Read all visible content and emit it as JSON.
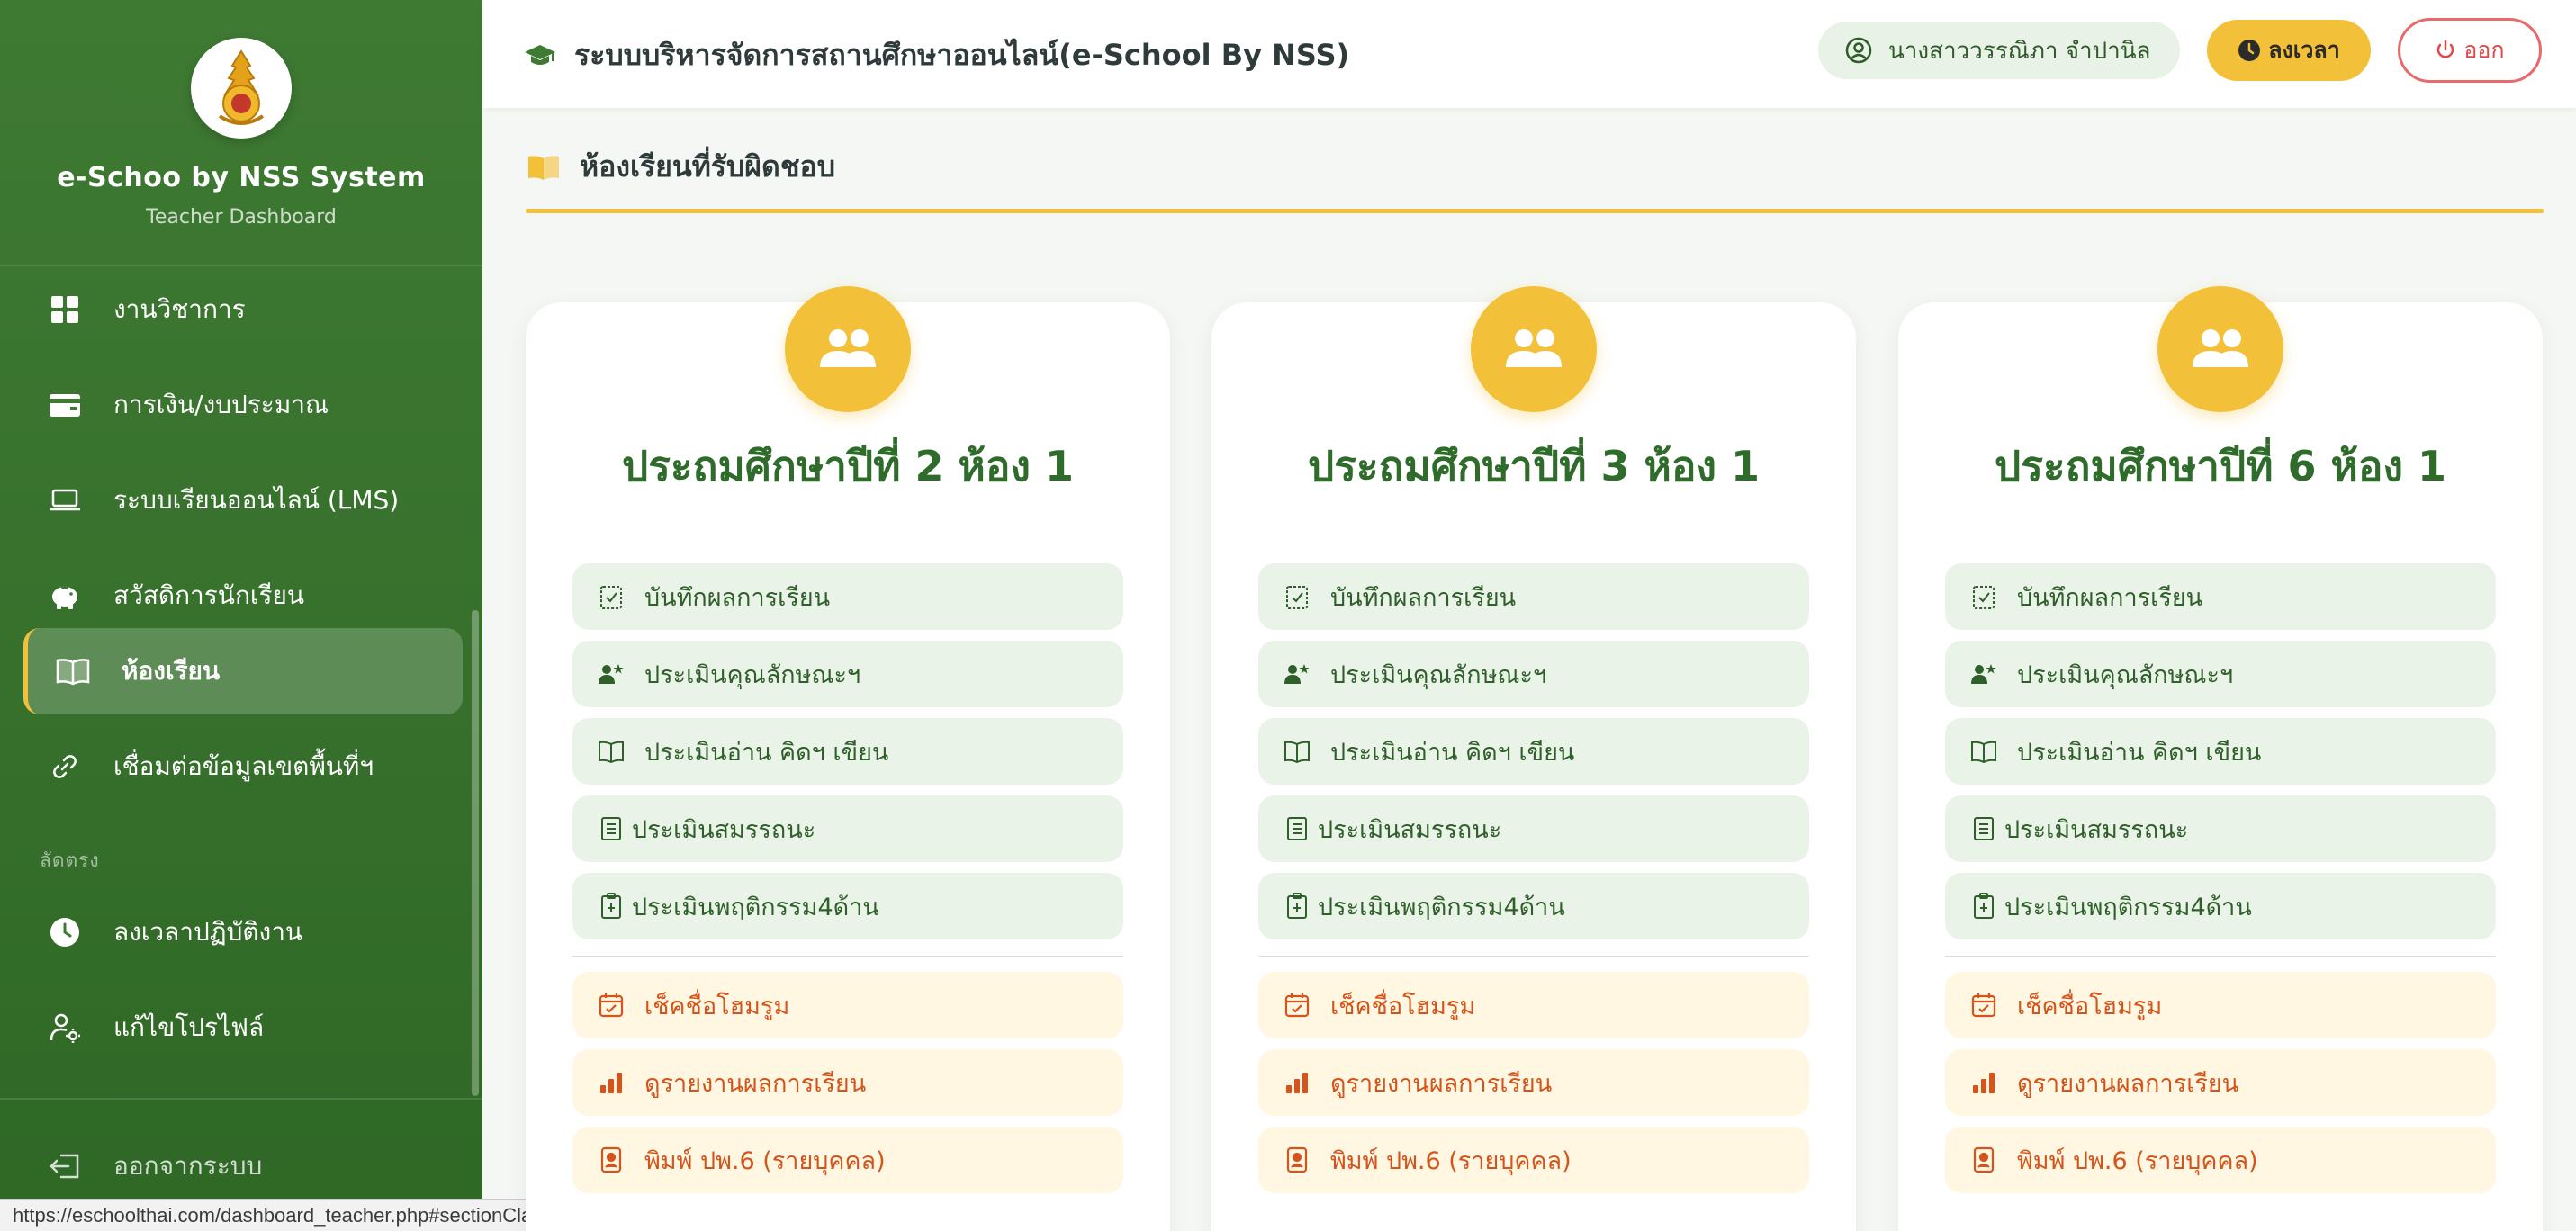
{
  "sidebar": {
    "brand_title": "e-Schoo by NSS System",
    "brand_subtitle": "Teacher Dashboard",
    "items": [
      {
        "label": "งานวิชาการ",
        "icon": "grid-icon"
      },
      {
        "label": "การเงิน/งบประมาณ",
        "icon": "wallet-icon"
      },
      {
        "label": "ระบบเรียนออนไลน์ (LMS)",
        "icon": "laptop-icon"
      },
      {
        "label": "สวัสดิการนักเรียน",
        "icon": "piggy-bank-icon"
      },
      {
        "label": "ห้องเรียน",
        "icon": "book-open-icon",
        "active": true
      },
      {
        "label": "เชื่อมต่อข้อมูลเขตพื้นที่ฯ",
        "icon": "link-icon"
      }
    ],
    "section_shortcut": "ลัดตรง",
    "shortcuts": [
      {
        "label": "ลงเวลาปฏิบัติงาน",
        "icon": "clock-icon"
      },
      {
        "label": "แก้ไขโปรไฟล์",
        "icon": "user-gear-icon"
      }
    ],
    "logout_label": "ออกจากระบบ"
  },
  "status_url": "https://eschoolthai.com/dashboard_teacher.php#sectionClassroom",
  "header": {
    "title": "ระบบบริหารจัดการสถานศึกษาออนไลน์(e-School By NSS)",
    "user_name": "นางสาววรรณิภา จำปานิล",
    "clock_button": "ลงเวลา",
    "logout_button": "ออก"
  },
  "section": {
    "title": "ห้องเรียนที่รับผิดชอบ"
  },
  "colors": {
    "sidebar": "#3f7a33",
    "accent": "#f3c03a",
    "title_green": "#2f6b2a",
    "orange_text": "#d4541c",
    "logout_red": "#e04a4a"
  },
  "classrooms": [
    {
      "title": "ประถมศึกษาปีที่ 2 ห้อง 1",
      "green_actions": [
        "บันทึกผลการเรียน",
        "ประเมินคุณลักษณะฯ",
        "ประเมินอ่าน คิดฯ เขียน",
        "ประเมินสมรรถนะ",
        "ประเมินพฤติกรรม4ด้าน"
      ],
      "orange_actions": [
        "เช็คชื่อโฮมรูม",
        "ดูรายงานผลการเรียน",
        "พิมพ์ ปพ.6 (รายบุคคล)"
      ]
    },
    {
      "title": "ประถมศึกษาปีที่ 3 ห้อง 1",
      "green_actions": [
        "บันทึกผลการเรียน",
        "ประเมินคุณลักษณะฯ",
        "ประเมินอ่าน คิดฯ เขียน",
        "ประเมินสมรรถนะ",
        "ประเมินพฤติกรรม4ด้าน"
      ],
      "orange_actions": [
        "เช็คชื่อโฮมรูม",
        "ดูรายงานผลการเรียน",
        "พิมพ์ ปพ.6 (รายบุคคล)"
      ]
    },
    {
      "title": "ประถมศึกษาปีที่ 6 ห้อง 1",
      "green_actions": [
        "บันทึกผลการเรียน",
        "ประเมินคุณลักษณะฯ",
        "ประเมินอ่าน คิดฯ เขียน",
        "ประเมินสมรรถนะ",
        "ประเมินพฤติกรรม4ด้าน"
      ],
      "orange_actions": [
        "เช็คชื่อโฮมรูม",
        "ดูรายงานผลการเรียน",
        "พิมพ์ ปพ.6 (รายบุคคล)"
      ]
    }
  ]
}
